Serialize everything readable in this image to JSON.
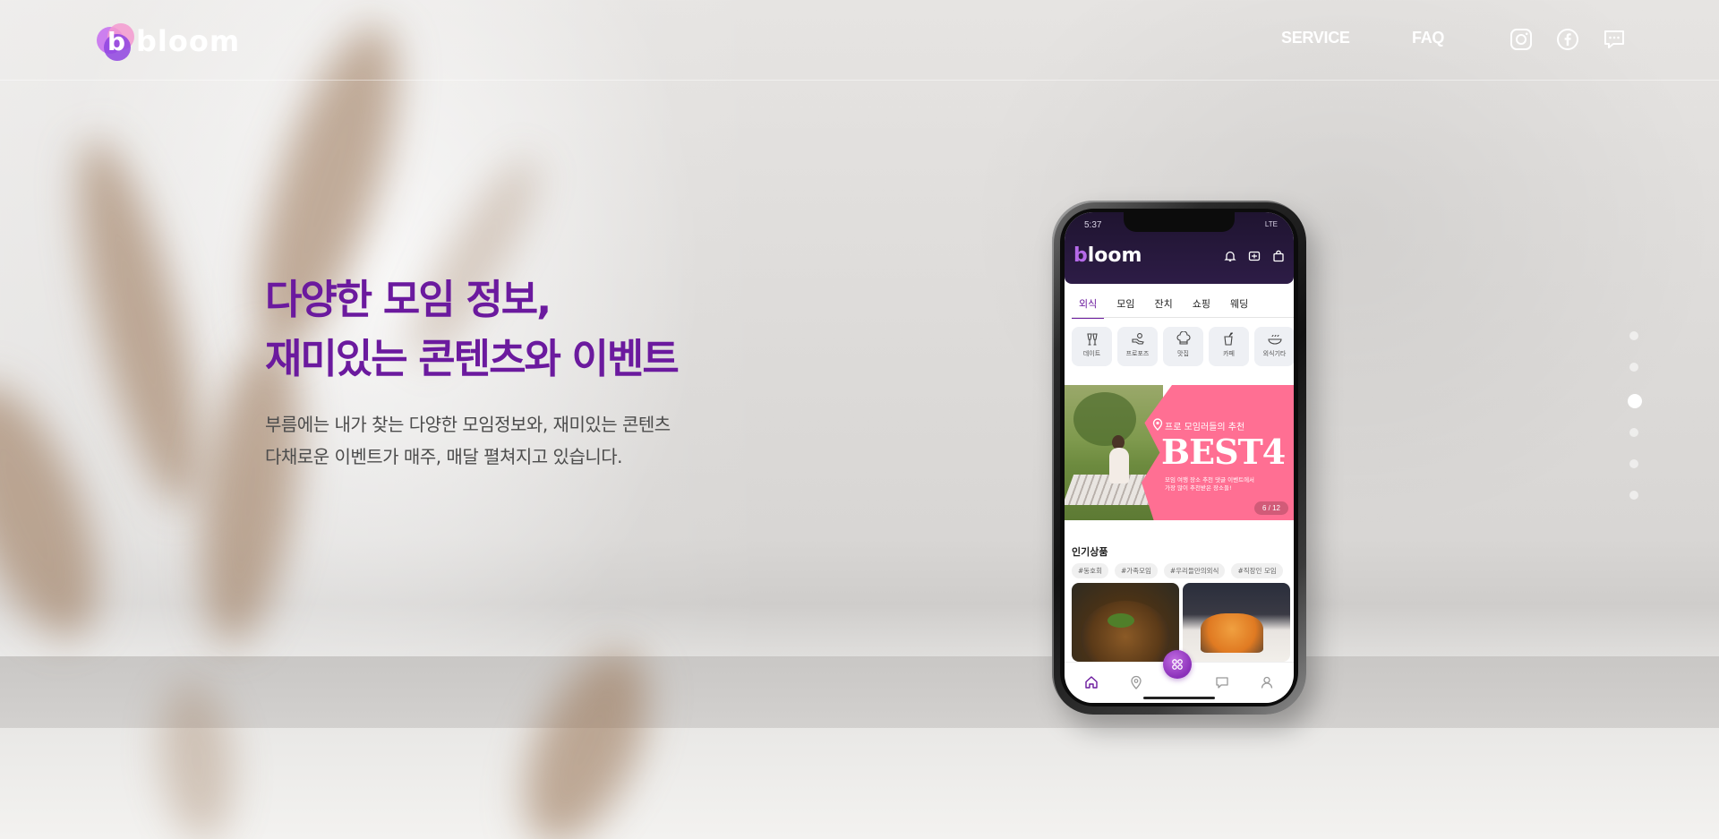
{
  "header": {
    "logo_text": "bloom",
    "logo_letter": "b",
    "nav": [
      {
        "label": "SERVICE"
      },
      {
        "label": "FAQ"
      }
    ],
    "social": [
      {
        "icon": "instagram-icon"
      },
      {
        "icon": "facebook-icon"
      },
      {
        "icon": "chat-icon"
      }
    ]
  },
  "hero": {
    "title_line1": "다양한 모임 정보,",
    "title_line2": "재미있는 콘텐츠와 이벤트",
    "desc_line1": "부름에는 내가 찾는 다양한 모임정보와, 재미있는 콘텐츠",
    "desc_line2": "다채로운 이벤트가 매주, 매달 펼쳐지고 있습니다."
  },
  "pagination": {
    "count": 6,
    "active_index": 2
  },
  "phone": {
    "status_time": "5:37",
    "status_right": "LTE",
    "app_logo_b": "b",
    "app_logo_rest": "loom",
    "tabs": [
      {
        "label": "외식",
        "active": true
      },
      {
        "label": "모임"
      },
      {
        "label": "잔치"
      },
      {
        "label": "쇼핑"
      },
      {
        "label": "웨딩"
      }
    ],
    "categories": [
      {
        "label": "데이트",
        "icon": "cheers-icon"
      },
      {
        "label": "프로포즈",
        "icon": "hand-icon"
      },
      {
        "label": "맛집",
        "icon": "chef-hat-icon"
      },
      {
        "label": "카페",
        "icon": "cup-icon"
      },
      {
        "label": "외식기타",
        "icon": "bowl-icon"
      }
    ],
    "banner": {
      "subtitle": "프로 모임러들의 추천",
      "headline": "BEST4",
      "desc_line1": "모임 여행 장소 추천 댓글 이벤트에서",
      "desc_line2": "가장 많이 추천받은 장소들!",
      "counter": "6 / 12"
    },
    "popular_title": "인기상품",
    "chips": [
      "#동호회",
      "#가족모임",
      "#우리들만의외식",
      "#직장인 모임"
    ],
    "accent": "#6b1a9e",
    "banner_color": "#ff6f93"
  }
}
